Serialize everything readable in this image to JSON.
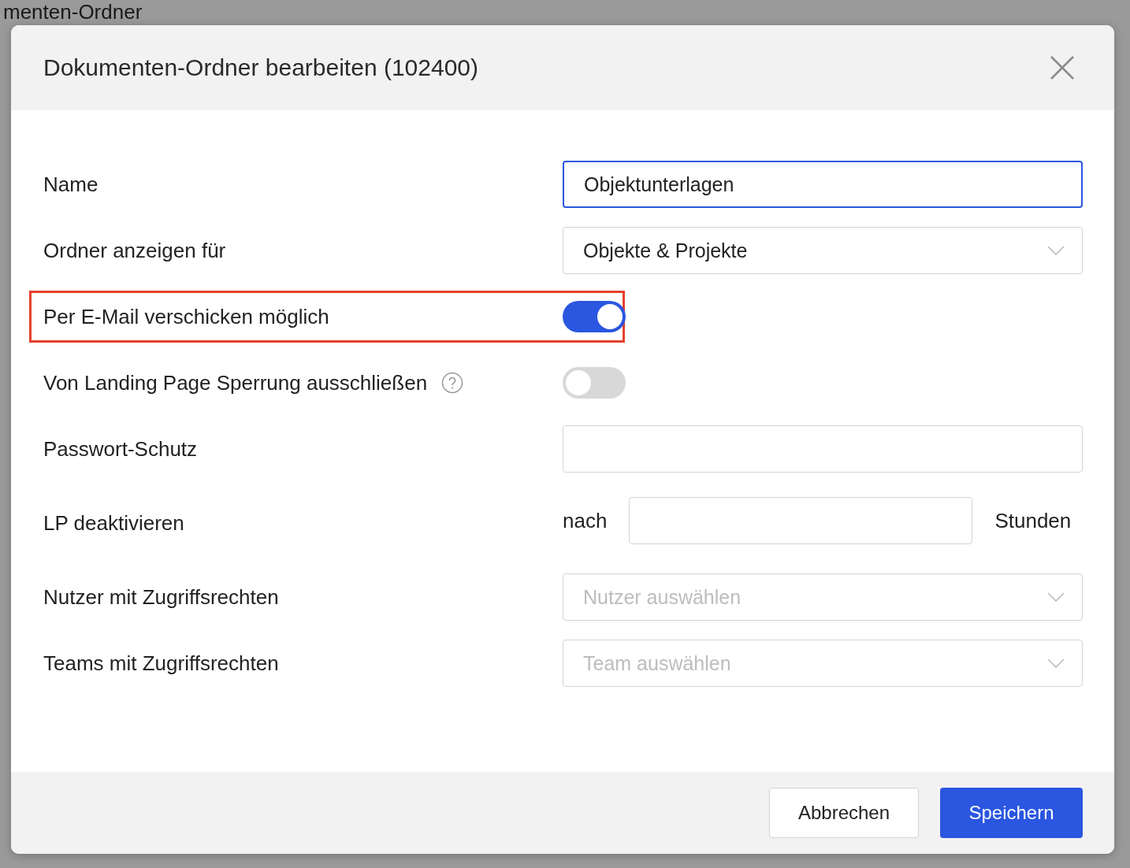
{
  "background": {
    "title": "menten-Ordner"
  },
  "dialog": {
    "title": "Dokumenten-Ordner bearbeiten (102400)",
    "fields": [
      {
        "kind": "input",
        "label": "Name",
        "value": "Objektunterlagen",
        "focused": true
      },
      {
        "kind": "select",
        "label": "Ordner anzeigen für",
        "value": "Objekte & Projekte"
      },
      {
        "kind": "toggle",
        "label": "Per E-Mail verschicken möglich",
        "on": true,
        "highlighted": true
      },
      {
        "kind": "toggle",
        "label": "Von Landing Page Sperrung ausschließen",
        "on": false,
        "help": true
      },
      {
        "kind": "input",
        "label": "Passwort-Schutz",
        "focused": false
      },
      {
        "kind": "hours",
        "label": "LP deaktivieren",
        "prefix": "nach",
        "suffix": "Stunden"
      },
      {
        "kind": "select",
        "label": "Nutzer mit Zugriffsrechten",
        "placeholder": "Nutzer auswählen"
      },
      {
        "kind": "select",
        "label": "Teams mit Zugriffsrechten",
        "placeholder": "Team auswählen"
      }
    ],
    "buttons": [
      {
        "label": "Abbrechen",
        "primary": false
      },
      {
        "label": "Speichern",
        "primary": true
      }
    ]
  }
}
